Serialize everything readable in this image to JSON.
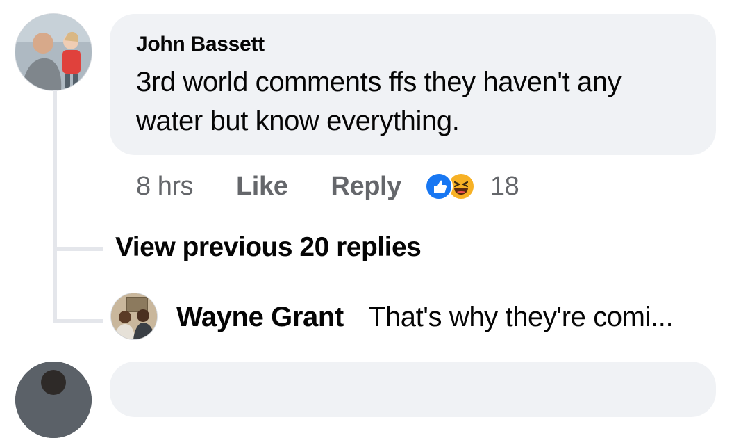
{
  "comment": {
    "author": "John Bassett",
    "text": "3rd world comments ffs they haven't any water but know everything.",
    "time": "8 hrs",
    "like_label": "Like",
    "reply_label": "Reply",
    "reaction_icons": [
      "like-icon",
      "haha-icon"
    ],
    "reaction_count": "18"
  },
  "replies": {
    "view_previous_label": "View previous 20 replies",
    "latest": {
      "author": "Wayne Grant",
      "text": "That's why they're comi..."
    }
  },
  "colors": {
    "bubble": "#f0f2f5",
    "meta_text": "#65676b",
    "like_blue": "#1877f2",
    "haha_yellow": "#f7b125",
    "thread_line": "#e4e6eb"
  }
}
